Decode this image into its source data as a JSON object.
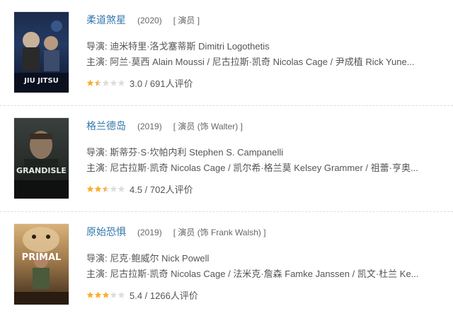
{
  "items": [
    {
      "title": "柔道煞星",
      "year": "(2020)",
      "role": "[ 演员 ]",
      "director": "导演: 迪米特里·洛戈塞蒂斯 Dimitri Logothetis",
      "cast": "主演: 阿兰·莫西 Alain Moussi / 尼古拉斯·凯奇 Nicolas Cage / 尹成植 Rick Yune...",
      "stars_value": 1.5,
      "rating_text": "3.0 / 691人评价",
      "poster": {
        "text": "JIU JITSU",
        "bg_top": "#1c2b4d",
        "bg_bottom": "#0d1629",
        "accent": "#f2f2f2"
      }
    },
    {
      "title": "格兰德岛",
      "year": "(2019)",
      "role": "[ 演员 (饰 Walter) ]",
      "director": "导演: 斯蒂芬·S·坎帕内利 Stephen S. Campanelli",
      "cast": "主演: 尼古拉斯·凯奇 Nicolas Cage / 凯尔希·格兰莫 Kelsey Grammer / 祖蕾·亨奥...",
      "stars_value": 2.5,
      "rating_text": "4.5 / 702人评价",
      "poster": {
        "text": "GRANDISLE",
        "bg_top": "#2f3533",
        "bg_bottom": "#151816",
        "accent": "#e6e6e6"
      }
    },
    {
      "title": "原始恐惧",
      "year": "(2019)",
      "role": "[ 演员 (饰 Frank Walsh) ]",
      "director": "导演: 尼克·鲍威尔 Nick Powell",
      "cast": "主演: 尼古拉斯·凯奇 Nicolas Cage / 法米克·詹森 Famke Janssen / 凯文·杜兰 Ke...",
      "stars_value": 3,
      "rating_text": "5.4 / 1266人评价",
      "poster": {
        "text": "PRIMAL",
        "bg_top": "#caa36a",
        "bg_bottom": "#4a3420",
        "accent": "#ffffff"
      }
    }
  ],
  "colors": {
    "link": "#3377aa",
    "text": "#555555",
    "meta": "#666666",
    "star_on": "#ffac2d",
    "star_off": "#dddddd"
  },
  "icons": {
    "star": "star-icon"
  }
}
